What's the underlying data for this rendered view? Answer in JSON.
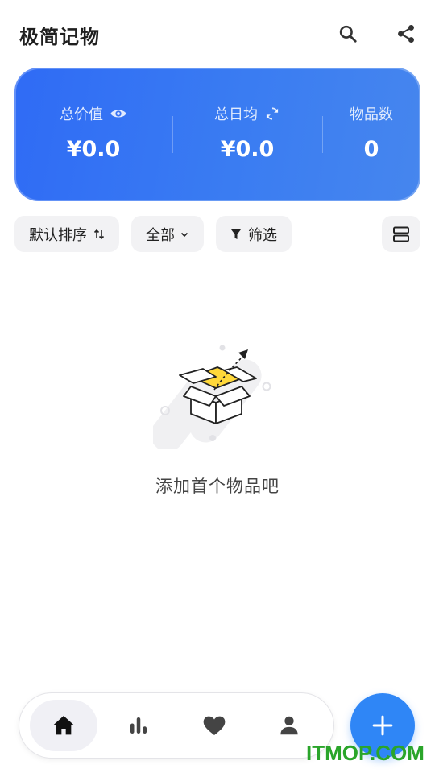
{
  "header": {
    "title": "极简记物",
    "search_icon": "search-icon",
    "share_icon": "share-icon"
  },
  "stats": {
    "total_value": {
      "label": "总价值",
      "value": "¥0.0",
      "icon": "eye-icon"
    },
    "daily_avg": {
      "label": "总日均",
      "value": "¥0.0",
      "icon": "refresh-icon"
    },
    "item_count": {
      "label": "物品数",
      "value": "0"
    }
  },
  "filters": {
    "sort_label": "默认排序",
    "category_label": "全部",
    "filter_label": "筛选",
    "layout_icon": "list-layout-icon"
  },
  "empty_state": {
    "message": "添加首个物品吧",
    "illustration": "open-box-icon"
  },
  "bottom_nav": {
    "items": [
      {
        "icon": "home-icon",
        "active": true
      },
      {
        "icon": "bar-chart-icon",
        "active": false
      },
      {
        "icon": "heart-icon",
        "active": false
      },
      {
        "icon": "person-icon",
        "active": false
      }
    ]
  },
  "fab": {
    "icon": "plus-icon"
  },
  "watermark": {
    "text": "ITMOP.COM"
  },
  "colors": {
    "accent": "#2f86f6",
    "card_gradient_start": "#2f6bf5",
    "card_gradient_end": "#4686ee",
    "chip_bg": "#f2f2f4",
    "watermark": "#2aa52a"
  }
}
